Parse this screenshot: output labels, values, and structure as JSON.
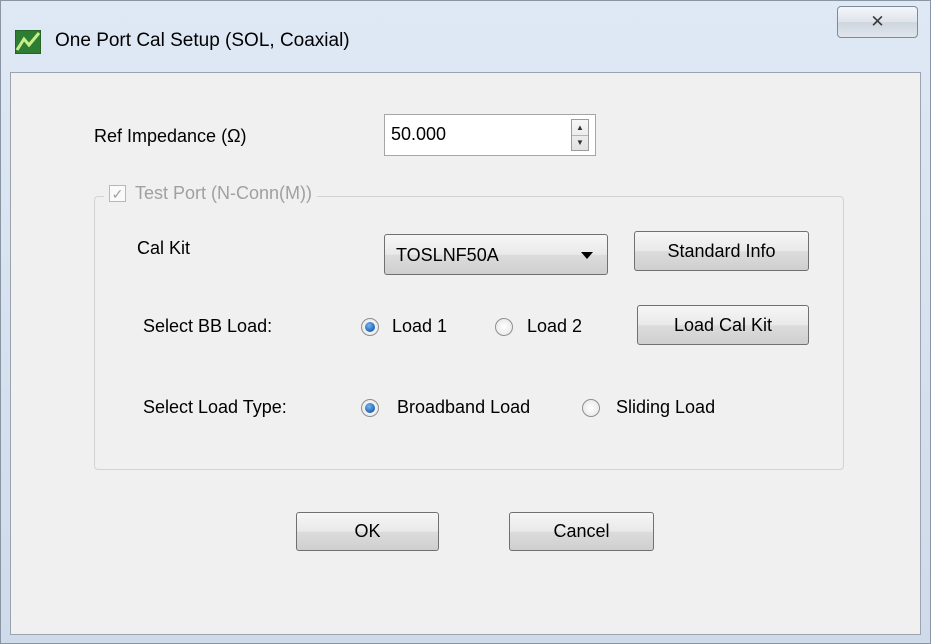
{
  "window": {
    "title": "One Port Cal Setup (SOL, Coaxial)",
    "close_glyph": "✕",
    "icon": "app-logo-icon"
  },
  "ref_impedance": {
    "label": "Ref Impedance (Ω)",
    "value": "50.000"
  },
  "test_port": {
    "label": "Test Port (N-Conn(M))",
    "checked": true,
    "enabled": false
  },
  "cal_kit": {
    "label": "Cal Kit",
    "selected": "TOSLNF50A",
    "standard_info_button": "Standard Info"
  },
  "bb_load": {
    "label": "Select BB Load:",
    "options": [
      "Load 1",
      "Load 2"
    ],
    "selected": "Load 1",
    "load_cal_kit_button": "Load Cal Kit"
  },
  "load_type": {
    "label": "Select Load Type:",
    "options": [
      "Broadband Load",
      "Sliding Load"
    ],
    "selected": "Broadband Load"
  },
  "footer": {
    "ok": "OK",
    "cancel": "Cancel"
  },
  "colors": {
    "accent_radio": "#1d64b8",
    "disabled_text": "#a0a0a0"
  }
}
